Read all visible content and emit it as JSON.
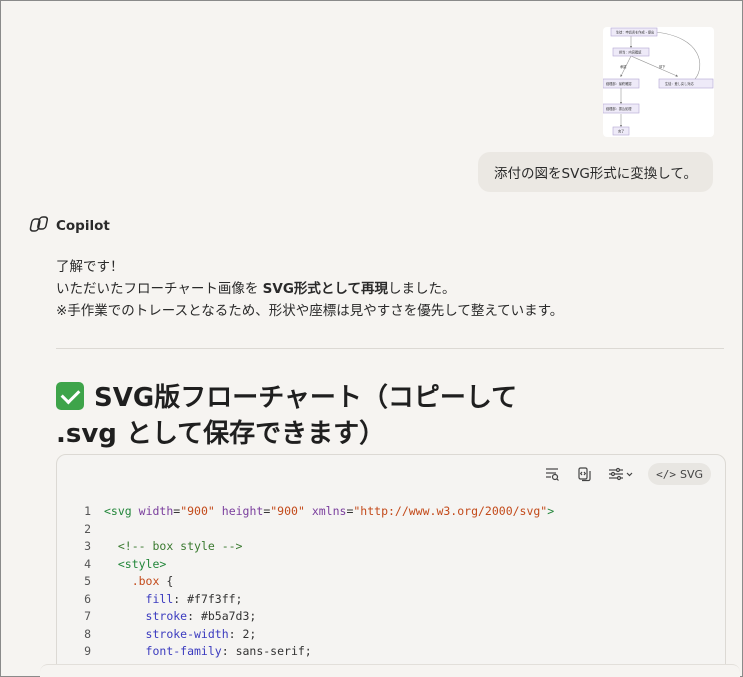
{
  "attachment": {
    "thumbnail_labels": [
      "生徒：申請書を作成・提出",
      "担当：内容確認",
      "承認",
      "却下",
      "経理部：最終確認",
      "生徒：差し戻し対応",
      "経理部：振込処理",
      "完了"
    ]
  },
  "user_message": "添付の図をSVG形式に変換して。",
  "assistant": {
    "name": "Copilot",
    "line1": "了解です！",
    "line2_before": "いただいたフローチャート画像を ",
    "line2_bold": "SVG形式として再現",
    "line2_after": "しました。",
    "line3": "※手作業でのトレースとなるため、形状や座標は見やすさを優先して整えています。",
    "heading_line1": "SVG版フローチャート（コピーして",
    "heading_line2": ".svg として保存できます）"
  },
  "code_block": {
    "language_label": "SVG",
    "icons": [
      "wrap-lines-icon",
      "copy-icon",
      "settings-sliders-icon",
      "code-icon"
    ],
    "lines": [
      {
        "n": "1",
        "tokens": [
          [
            "t",
            "<svg"
          ],
          [
            "p",
            " "
          ],
          [
            "a",
            "width"
          ],
          [
            "p",
            "="
          ],
          [
            "v",
            "\"900\""
          ],
          [
            "p",
            " "
          ],
          [
            "a",
            "height"
          ],
          [
            "p",
            "="
          ],
          [
            "v",
            "\"900\""
          ],
          [
            "p",
            " "
          ],
          [
            "a",
            "xmlns"
          ],
          [
            "p",
            "="
          ],
          [
            "v",
            "\"http://www.w3.org/2000/svg\""
          ],
          [
            "t",
            ">"
          ]
        ]
      },
      {
        "n": "2",
        "tokens": []
      },
      {
        "n": "3",
        "tokens": [
          [
            "p",
            "  "
          ],
          [
            "c",
            "<!-- box style -->"
          ]
        ]
      },
      {
        "n": "4",
        "tokens": [
          [
            "p",
            "  "
          ],
          [
            "t",
            "<style>"
          ]
        ]
      },
      {
        "n": "5",
        "tokens": [
          [
            "p",
            "    "
          ],
          [
            "sel",
            ".box"
          ],
          [
            "p",
            " {"
          ]
        ]
      },
      {
        "n": "6",
        "tokens": [
          [
            "p",
            "      "
          ],
          [
            "prop",
            "fill"
          ],
          [
            "p",
            ": #f7f3ff;"
          ]
        ]
      },
      {
        "n": "7",
        "tokens": [
          [
            "p",
            "      "
          ],
          [
            "prop",
            "stroke"
          ],
          [
            "p",
            ": #b5a7d3;"
          ]
        ]
      },
      {
        "n": "8",
        "tokens": [
          [
            "p",
            "      "
          ],
          [
            "prop",
            "stroke-width"
          ],
          [
            "p",
            ": 2;"
          ]
        ]
      },
      {
        "n": "9",
        "tokens": [
          [
            "p",
            "      "
          ],
          [
            "prop",
            "font-family"
          ],
          [
            "p",
            ": sans-serif;"
          ]
        ]
      }
    ]
  }
}
